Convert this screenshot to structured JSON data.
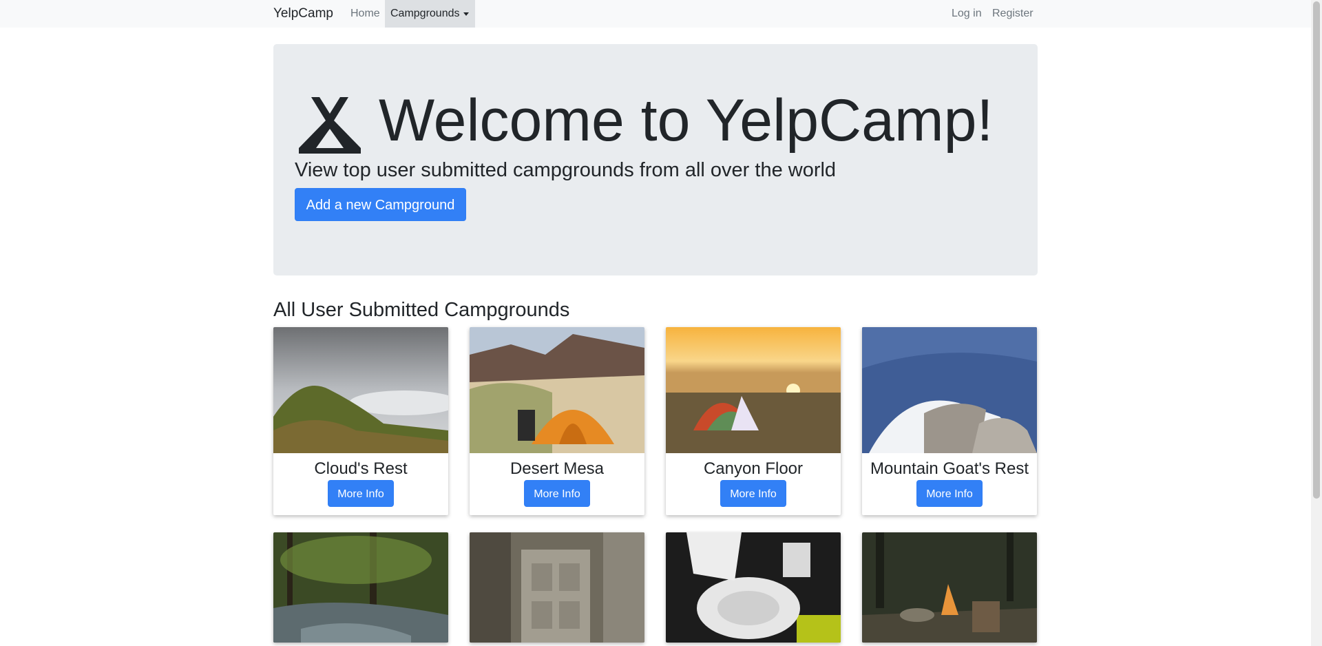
{
  "navbar": {
    "brand": "YelpCamp",
    "home": "Home",
    "campgrounds": "Campgrounds",
    "login": "Log in",
    "register": "Register"
  },
  "jumbotron": {
    "title": "Welcome to YelpCamp!",
    "lead": "View top user submitted campgrounds from all over the world",
    "button": "Add a new Campground"
  },
  "section": {
    "heading": "All User Submitted Campgrounds"
  },
  "campgrounds": [
    {
      "name": "Cloud's Rest",
      "button": "More Info"
    },
    {
      "name": "Desert Mesa",
      "button": "More Info"
    },
    {
      "name": "Canyon Floor",
      "button": "More Info"
    },
    {
      "name": "Mountain Goat's Rest",
      "button": "More Info"
    }
  ],
  "colors": {
    "primary": "#3280f6",
    "navbar_bg": "#f8f9fa",
    "jumbotron_bg": "#e9ecef",
    "text": "#212529"
  },
  "icons": {
    "tent": "campground-icon"
  }
}
